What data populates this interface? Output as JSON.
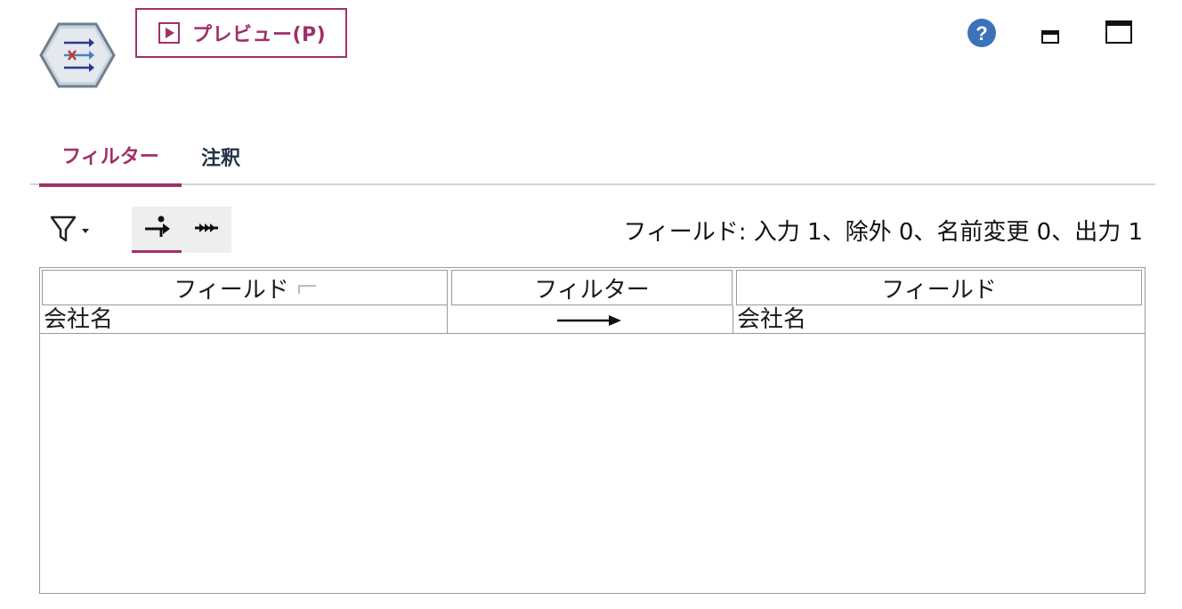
{
  "header": {
    "node_icon": "filter-node-icon",
    "preview_label": "プレビュー(P)",
    "preview_icon": "play-icon",
    "help_icon": "help-icon",
    "minimize_icon": "minimize-icon",
    "maximize_icon": "maximize-icon"
  },
  "tabs": [
    {
      "label": "フィルター",
      "active": true
    },
    {
      "label": "注釈",
      "active": false
    }
  ],
  "toolbar": {
    "filter_menu_icon": "filter-funnel-icon",
    "view_input_icon": "input-fields-icon",
    "view_output_icon": "output-fields-icon",
    "summary": "フィールド: 入力 1、除外 0、名前変更 0、出力 1"
  },
  "table": {
    "columns": [
      "フィールド",
      "フィルター",
      "フィールド"
    ],
    "rows": [
      {
        "input_field": "会社名",
        "filter": "pass-arrow",
        "output_field": "会社名"
      }
    ]
  },
  "colors": {
    "accent": "#a0306a",
    "help_blue": "#3b73b9",
    "border": "#9a9a9a"
  }
}
